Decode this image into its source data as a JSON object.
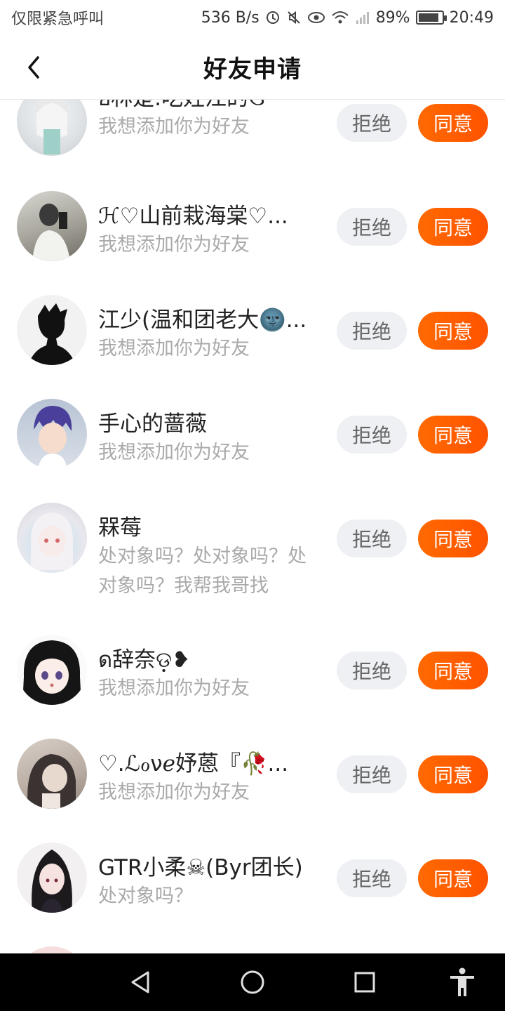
{
  "status_bar": {
    "left_text": "仅限紧急呼叫",
    "network_speed": "536 B/s",
    "battery_percent": "89%",
    "battery_level": 0.89,
    "time": "20:49",
    "icons": [
      "data-saver-icon",
      "mute-icon",
      "eye-comfort-icon",
      "wifi-icon",
      "signal-icon",
      "battery-icon"
    ]
  },
  "header": {
    "title": "好友申请",
    "back_icon": "chevron-left-icon"
  },
  "buttons": {
    "reject_label": "拒绝",
    "accept_label": "同意"
  },
  "requests": [
    {
      "name": "ยิ林楚.吃姓江的ઉ",
      "message": "我想添加你为好友"
    },
    {
      "name": "ℋ♡山前栽海棠♡...",
      "message": "我想添加你为好友"
    },
    {
      "name": "江少(温和团老大🌚...",
      "message": "我想添加你为好友"
    },
    {
      "name": "手心的蔷薇",
      "message": "我想添加你为好友"
    },
    {
      "name": "槑莓",
      "message": "处对象吗？处对象吗？处对象吗？我帮我哥找"
    },
    {
      "name": "ด辞奈ଡ଼❥",
      "message": "我想添加你为好友"
    },
    {
      "name": "♡.ℒℴνℯ妤蒽『🥀...",
      "message": "我想添加你为好友"
    },
    {
      "name": "GTR小柔☠(Byr团长)",
      "message": "处对象吗？"
    }
  ],
  "colors": {
    "accent": "#ff5a00",
    "reject_bg": "#eef0f4",
    "secondary_text": "#aaaaaa"
  },
  "nav_bar": {
    "icons": [
      "back-triangle-icon",
      "home-circle-icon",
      "recents-square-icon",
      "accessibility-icon"
    ]
  }
}
